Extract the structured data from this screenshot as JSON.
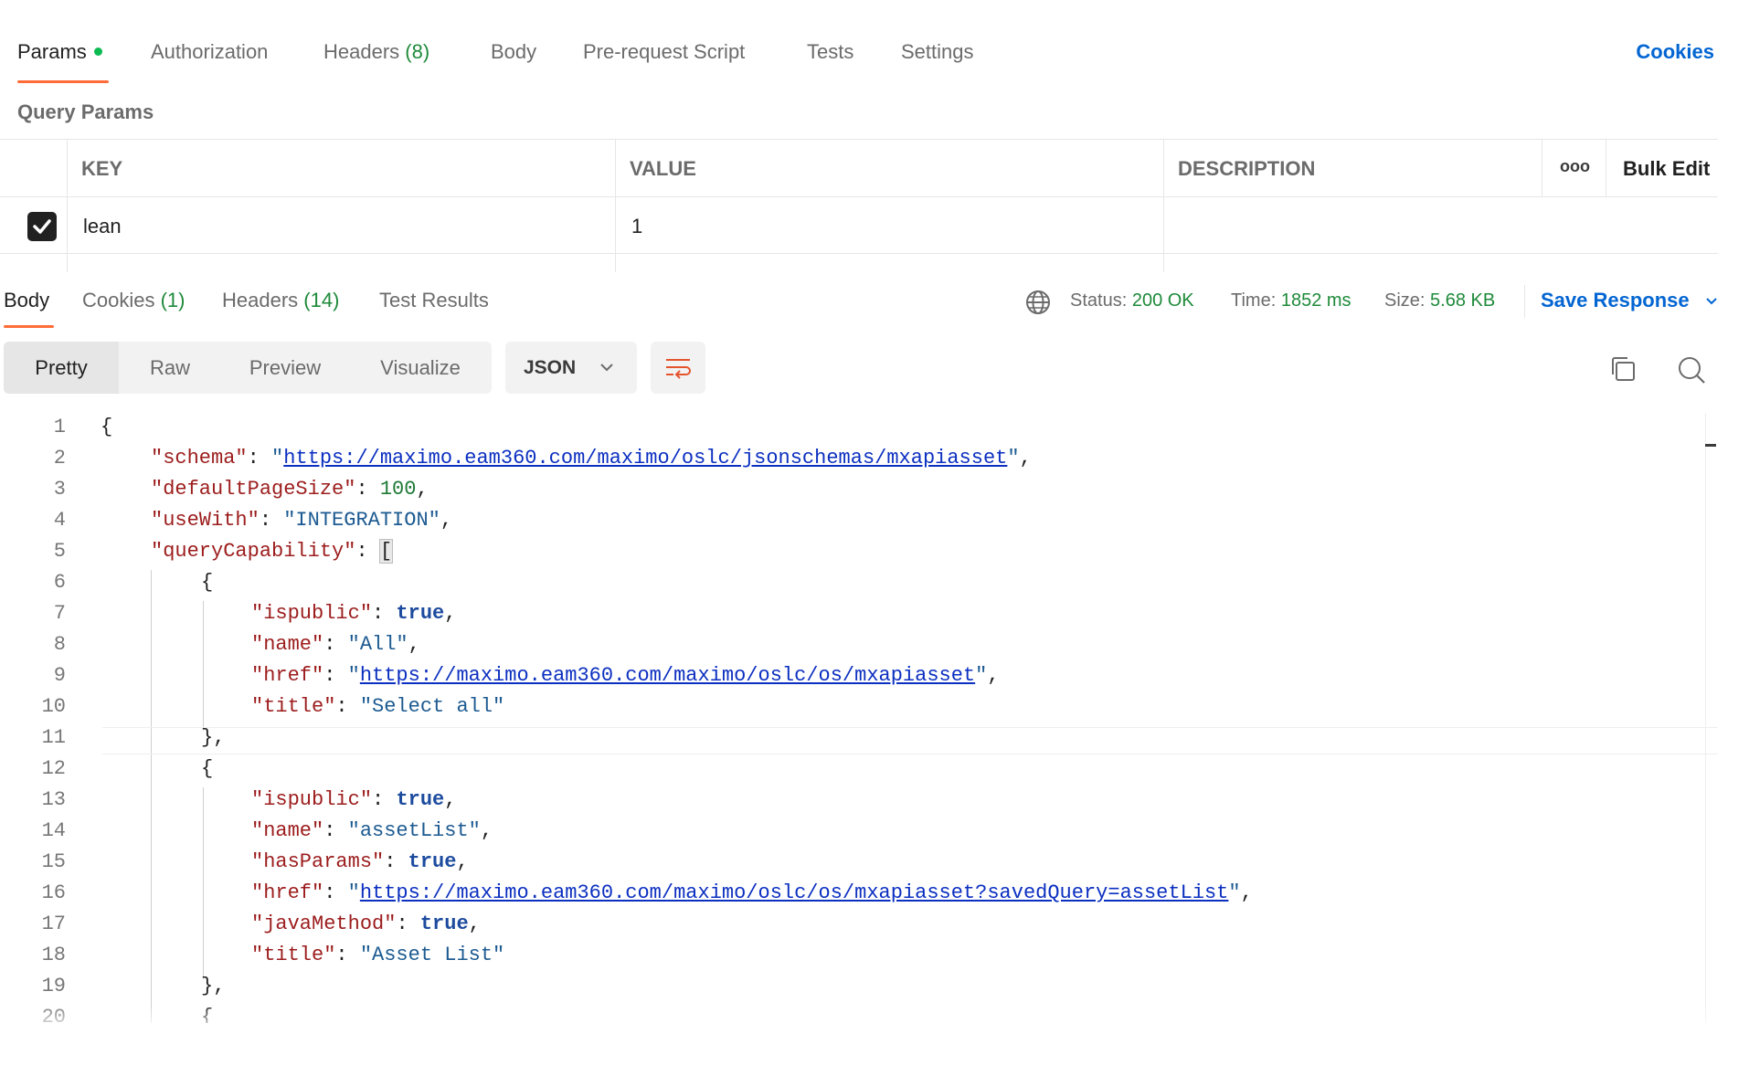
{
  "request_tabs": [
    {
      "label": "Params",
      "count": ""
    },
    {
      "label": "Authorization",
      "count": ""
    },
    {
      "label": "Headers",
      "count": "(8)"
    },
    {
      "label": "Body",
      "count": ""
    },
    {
      "label": "Pre-request Script",
      "count": ""
    },
    {
      "label": "Tests",
      "count": ""
    },
    {
      "label": "Settings",
      "count": ""
    }
  ],
  "cookies_link": "Cookies",
  "query_params": {
    "title": "Query Params",
    "headers": {
      "key": "KEY",
      "value": "VALUE",
      "description": "DESCRIPTION",
      "more": "ooo",
      "bulk_edit": "Bulk Edit"
    },
    "rows": [
      {
        "checked": true,
        "key": "lean",
        "value": "1",
        "description": ""
      }
    ]
  },
  "response_tabs": [
    {
      "label": "Body",
      "count": ""
    },
    {
      "label": "Cookies",
      "count": "(1)"
    },
    {
      "label": "Headers",
      "count": "(14)"
    },
    {
      "label": "Test Results",
      "count": ""
    }
  ],
  "response_meta": {
    "status_label": "Status:",
    "status_value": "200 OK",
    "time_label": "Time:",
    "time_value": "1852 ms",
    "size_label": "Size:",
    "size_value": "5.68 KB",
    "save_response": "Save Response"
  },
  "view_modes": [
    "Pretty",
    "Raw",
    "Preview",
    "Visualize"
  ],
  "format": "JSON",
  "code_lines": [
    "{",
    "\"schema\": \"https://maximo.eam360.com/maximo/oslc/jsonschemas/mxapiasset\",",
    "\"defaultPageSize\": 100,",
    "\"useWith\": \"INTEGRATION\",",
    "\"queryCapability\": [",
    "{",
    "\"ispublic\": true,",
    "\"name\": \"All\",",
    "\"href\": \"https://maximo.eam360.com/maximo/oslc/os/mxapiasset\",",
    "\"title\": \"Select all\"",
    "},",
    "{",
    "\"ispublic\": true,",
    "\"name\": \"assetList\",",
    "\"hasParams\": true,",
    "\"href\": \"https://maximo.eam360.com/maximo/oslc/os/mxapiasset?savedQuery=assetList\",",
    "\"javaMethod\": true,",
    "\"title\": \"Asset List\"",
    "},",
    "{"
  ],
  "colors": {
    "accent": "#ff6c37",
    "link": "#0265d2",
    "success": "#1e8a3a",
    "key": "#9c1c1c",
    "string": "#1c5a91"
  }
}
